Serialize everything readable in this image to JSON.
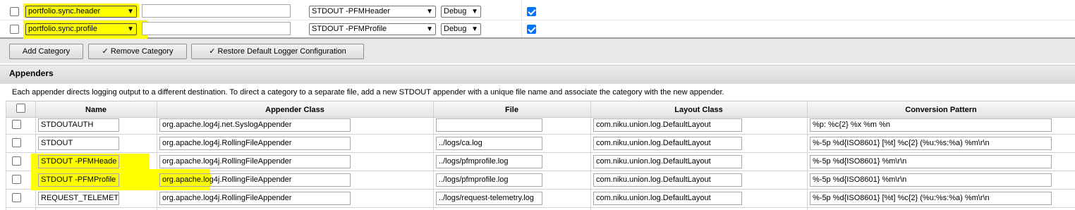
{
  "categories": [
    {
      "name": "portfolio.sync.header",
      "extra": "",
      "appender": "STDOUT -PFMHeader",
      "level": "Debug",
      "checked": false,
      "enabled": true
    },
    {
      "name": "portfolio.sync.profile",
      "extra": "",
      "appender": "STDOUT -PFMProfile",
      "level": "Debug",
      "checked": false,
      "enabled": true
    }
  ],
  "buttons": {
    "add_category": "Add Category",
    "remove_category": "Remove Category",
    "restore_default": "Restore Default Logger Configuration"
  },
  "appenders_section": {
    "title": "Appenders",
    "description": "Each appender directs logging output to a different destination. To direct a category to a separate file, add a new STDOUT appender with a unique file name and associate the category with the new appender."
  },
  "table": {
    "headers": [
      "Name",
      "Appender Class",
      "File",
      "Layout Class",
      "Conversion Pattern"
    ],
    "rows": [
      {
        "name": "STDOUTAUTH",
        "appender_class": "org.apache.log4j.net.SyslogAppender",
        "file": "",
        "layout_class": "com.niku.union.log.DefaultLayout",
        "pattern": "%p: %c{2} %x %m %n"
      },
      {
        "name": "STDOUT",
        "appender_class": "org.apache.log4j.RollingFileAppender",
        "file": "../logs/ca.log",
        "layout_class": "com.niku.union.log.DefaultLayout",
        "pattern": "%-5p %d{ISO8601} [%t] %c{2} (%u:%s:%a) %m\\r\\n"
      },
      {
        "name": "STDOUT -PFMHeade",
        "appender_class": "org.apache.log4j.RollingFileAppender",
        "file": "../logs/pfmprofile.log",
        "layout_class": "com.niku.union.log.DefaultLayout",
        "pattern": "%-5p %d{ISO8601} %m\\r\\n"
      },
      {
        "name": "STDOUT -PFMProfile",
        "appender_class": "org.apache.log4j.RollingFileAppender",
        "file": "../logs/pfmprofile.log",
        "layout_class": "com.niku.union.log.DefaultLayout",
        "pattern": "%-5p %d{ISO8601} %m\\r\\n"
      },
      {
        "name": "REQUEST_TELEMET",
        "appender_class": "org.apache.log4j.RollingFileAppender",
        "file": "../logs/request-telemetry.log",
        "layout_class": "com.niku.union.log.DefaultLayout",
        "pattern": "%-5p %d{ISO8601} [%t] %c{2} (%u:%s:%a) %m\\r\\n"
      }
    ]
  },
  "icons": {
    "dropdown": "chevron-down-icon",
    "checkmark": "check-icon"
  },
  "colors": {
    "highlight": "#ffff00",
    "section_header_bg": "#e0e0e0",
    "checkbox_checked": "#0075ff"
  }
}
